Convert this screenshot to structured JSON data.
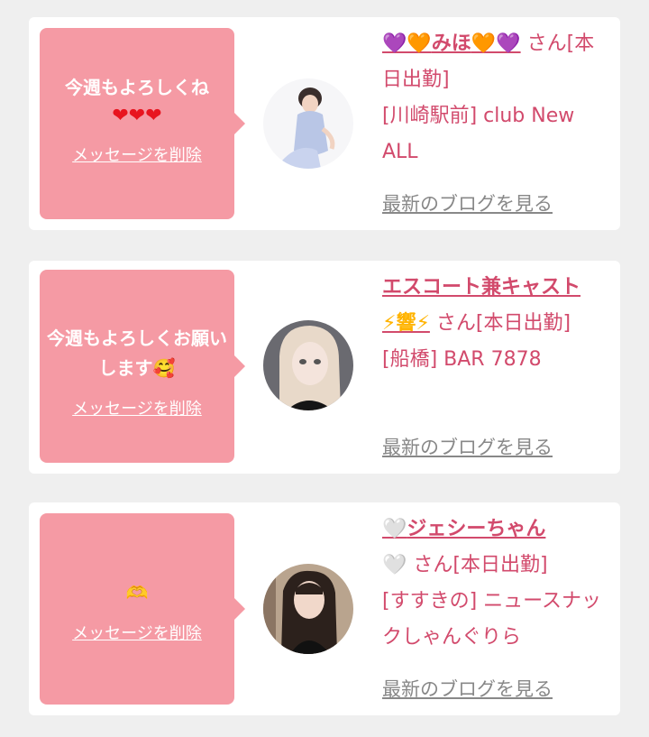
{
  "items": [
    {
      "message": "今週もよろしくね",
      "message_emoji": "❤❤❤",
      "delete_label": "メッセージを削除",
      "name_prefix": "💜🧡",
      "name_text": "みほ",
      "name_suffix": "🧡💜",
      "san_label": "さん[本日出勤]",
      "location_line": "[川崎駅前] club New ALL",
      "blog_label": "最新のブログを見る"
    },
    {
      "message": "今週もよろしくお願いします🥰",
      "message_emoji": "",
      "delete_label": "メッセージを削除",
      "name_prefix": "",
      "name_text": "エスコート兼キャスト",
      "name_suffix": "⚡響⚡",
      "san_label": "さん[本日出勤]",
      "location_line": "[船橋] BAR 7878",
      "blog_label": "最新のブログを見る"
    },
    {
      "message": "🫶",
      "message_emoji": "",
      "delete_label": "メッセージを削除",
      "name_prefix": "🤍",
      "name_text": "ジェシーちゃん",
      "name_suffix": "🤍",
      "san_label": "さん[本日出勤]",
      "location_line": "[すすきの] ニュースナックしゃんぐりら",
      "blog_label": "最新のブログを見る"
    }
  ],
  "colors": {
    "page_bg": "#efefef",
    "bubble": "#f59aa4",
    "name_text": "#d24a6c",
    "blog_link": "#888888"
  }
}
